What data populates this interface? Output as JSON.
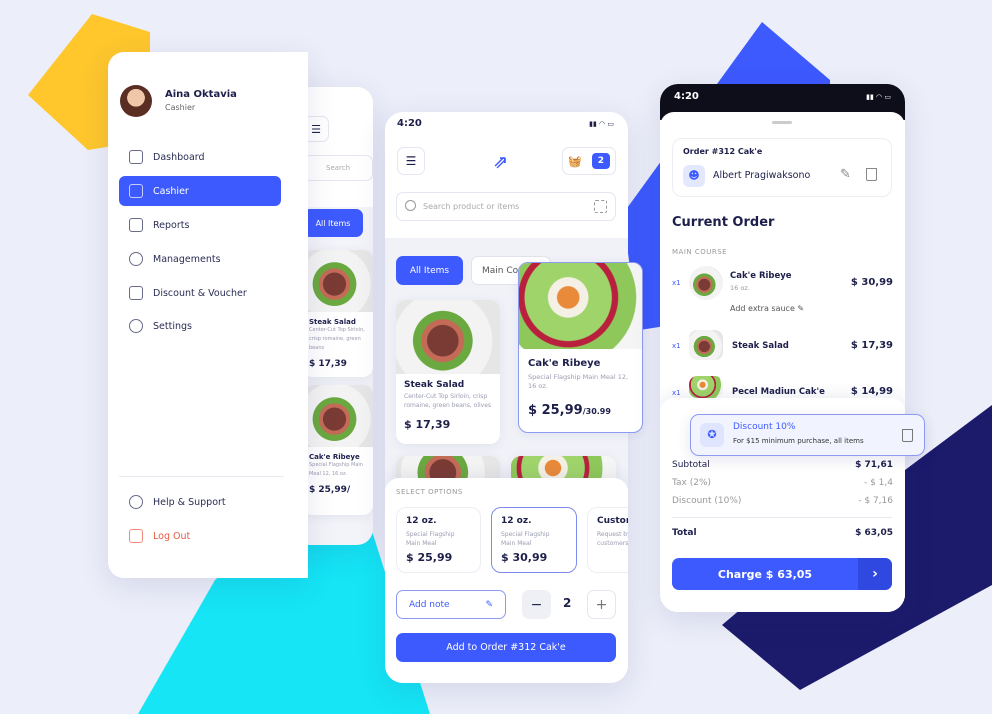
{
  "colors": {
    "accent": "#3d5afe",
    "danger": "#e9573f",
    "yellow": "#ffc72c",
    "cyan": "#15e5f5",
    "navy": "#1b1a6b",
    "bg": "#eceef9"
  },
  "sidebar": {
    "user_name": "Aina Oktavia",
    "user_role": "Cashier",
    "items": [
      {
        "label": "Dashboard",
        "icon": "home-icon"
      },
      {
        "label": "Cashier",
        "icon": "cashier-icon",
        "active": true
      },
      {
        "label": "Reports",
        "icon": "reports-icon"
      },
      {
        "label": "Managements",
        "icon": "user-icon"
      },
      {
        "label": "Discount & Voucher",
        "icon": "ticket-icon"
      },
      {
        "label": "Settings",
        "icon": "gear-icon"
      }
    ],
    "help": "Help & Support",
    "logout": "Log Out"
  },
  "back_screen": {
    "search_placeholder": "Search",
    "chip": "All Items",
    "items": [
      {
        "name": "Steak Salad",
        "desc": "Center-Cut Top Sirloin, crisp romaine, green beans",
        "price": "$ 17,39"
      },
      {
        "name": "Cak'e Ribeye",
        "desc": "Special Flagship Main Meal 12, 16 oz.",
        "price": "$ 25,99/"
      }
    ]
  },
  "middle": {
    "time": "4:20",
    "cart_count": "2",
    "search_placeholder": "Search product or items",
    "chips": [
      "All Items",
      "Main Course"
    ],
    "products": [
      {
        "name": "Steak Salad",
        "desc": "Center-Cut Top Sirloin, crisp romaine, green beans, olives",
        "price": "$ 17,39"
      },
      {
        "name": "Cak'e Ribeye",
        "desc": "Special Flagship Main Meal 12, 16 oz.",
        "price": "$ 25,99",
        "old_price": "/30.99"
      }
    ],
    "options_label": "SELECT OPTIONS",
    "options": [
      {
        "title": "12 oz.",
        "desc": "Special Flagship Main Meal",
        "price": "$ 25,99"
      },
      {
        "title": "12 oz.",
        "desc": "Special Flagship Main Meal",
        "price": "$ 30,99",
        "selected": true
      },
      {
        "title": "Custom",
        "desc": "Request by customers"
      }
    ],
    "add_note": "Add note",
    "quantity": "2",
    "add_button": "Add to Order #312 Cak'e"
  },
  "right": {
    "time": "4:20",
    "order_title": "Order #312 Cak'e",
    "customer": "Albert Pragiwaksono",
    "heading": "Current Order",
    "section": "MAIN COURSE",
    "items": [
      {
        "qty": "x1",
        "name": "Cak'e Ribeye",
        "sub": "16 oz.",
        "note": "Add extra sauce",
        "price": "$ 30,99"
      },
      {
        "qty": "x1",
        "name": "Steak Salad",
        "price": "$ 17,39"
      },
      {
        "qty": "x1",
        "name": "Pecel Madiun Cak'e",
        "price": "$ 14,99"
      }
    ],
    "discount_title": "Discount 10%",
    "discount_desc": "For $15 minimum purchase, all items",
    "summary": [
      {
        "label": "Subtotal",
        "value": "$ 71,61"
      },
      {
        "label": "Tax (2%)",
        "value": "- $ 1,4"
      },
      {
        "label": "Discount (10%)",
        "value": "- $ 7,16"
      }
    ],
    "total_label": "Total",
    "total_value": "$ 63,05",
    "charge": "Charge $ 63,05"
  }
}
